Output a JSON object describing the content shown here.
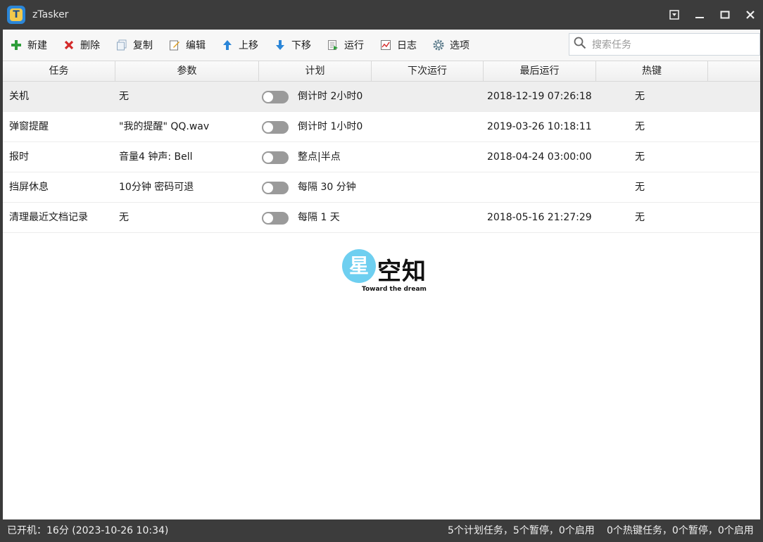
{
  "app": {
    "title": "zTasker",
    "logo_letter": "T"
  },
  "toolbar": {
    "new": "新建",
    "delete": "删除",
    "copy": "复制",
    "edit": "编辑",
    "move_up": "上移",
    "move_down": "下移",
    "run": "运行",
    "log": "日志",
    "options": "选项"
  },
  "search": {
    "placeholder": "搜索任务"
  },
  "columns": [
    "任务",
    "参数",
    "计划",
    "下次运行",
    "最后运行",
    "热键"
  ],
  "tasks": [
    {
      "name": "关机",
      "params": "无",
      "enabled": false,
      "schedule": "倒计时 2小时0",
      "next_run": "",
      "last_run": "2018-12-19 07:26:18",
      "hotkey": "无",
      "selected": true
    },
    {
      "name": "弹窗提醒",
      "params": "\"我的提醒\" QQ.wav",
      "enabled": false,
      "schedule": "倒计时 1小时0",
      "next_run": "",
      "last_run": "2019-03-26 10:18:11",
      "hotkey": "无",
      "selected": false
    },
    {
      "name": "报时",
      "params": "音量4 钟声: Bell",
      "enabled": false,
      "schedule": "整点|半点",
      "next_run": "",
      "last_run": "2018-04-24 03:00:00",
      "hotkey": "无",
      "selected": false
    },
    {
      "name": "挡屏休息",
      "params": "10分钟 密码可退",
      "enabled": false,
      "schedule": "每隔 30 分钟",
      "next_run": "",
      "last_run": "",
      "hotkey": "无",
      "selected": false
    },
    {
      "name": "清理最近文档记录",
      "params": "无",
      "enabled": false,
      "schedule": "每隔 1 天",
      "next_run": "",
      "last_run": "2018-05-16 21:27:29",
      "hotkey": "无",
      "selected": false
    }
  ],
  "watermark": {
    "badge": "星",
    "title": "空知",
    "subtitle": "Toward the dream"
  },
  "status": {
    "uptime": "已开机：16分 (2023-10-26 10:34)",
    "scheduled": "5个计划任务，5个暂停，0个启用",
    "hotkeys": "0个热键任务，0个暂停，0个启用"
  },
  "colors": {
    "titlebar": "#3c3c3c",
    "toggle_off": "#9a9a9a",
    "accent_blue": "#2b86d8"
  }
}
